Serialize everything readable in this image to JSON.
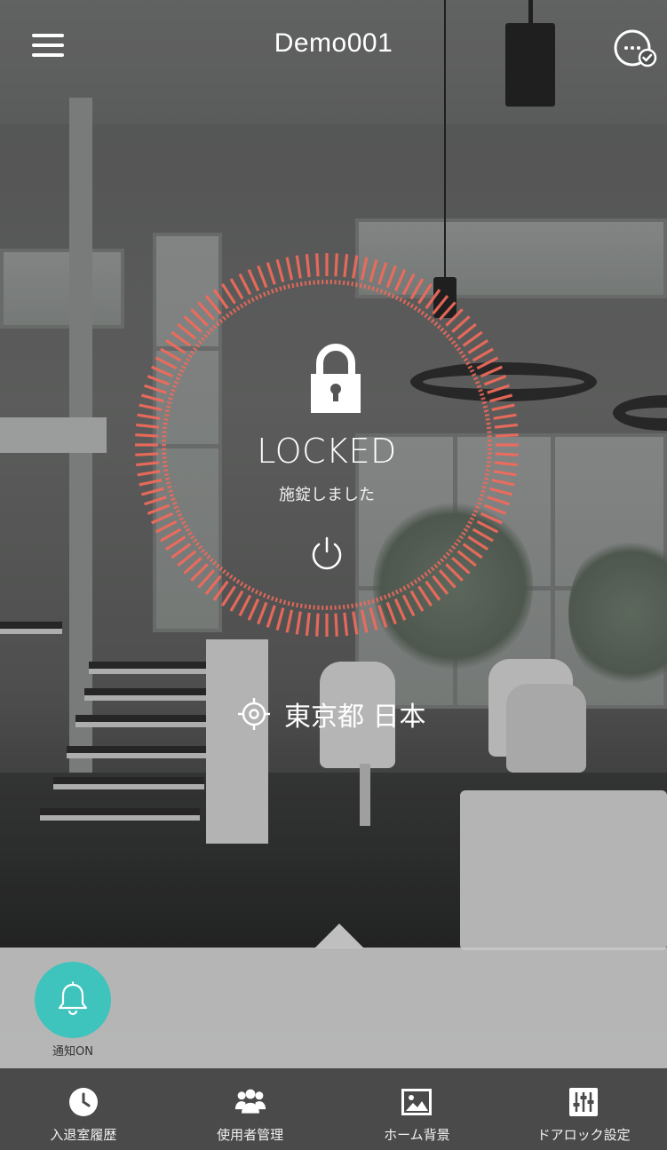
{
  "header": {
    "title": "Demo001"
  },
  "lock": {
    "status_en": "LOCKED",
    "status_jp": "施錠しました"
  },
  "location": {
    "text": "東京都 日本"
  },
  "notification": {
    "label": "通知ON"
  },
  "tabs": [
    {
      "label": "入退室履歴",
      "icon": "clock-icon"
    },
    {
      "label": "使用者管理",
      "icon": "users-icon"
    },
    {
      "label": "ホーム背景",
      "icon": "image-icon"
    },
    {
      "label": "ドアロック設定",
      "icon": "settings-sliders-icon"
    }
  ],
  "colors": {
    "ring": "#f26b5b",
    "notification": "#3ec3bd",
    "tabbar": "#4a4a4a",
    "panel": "#c8c8c8"
  }
}
